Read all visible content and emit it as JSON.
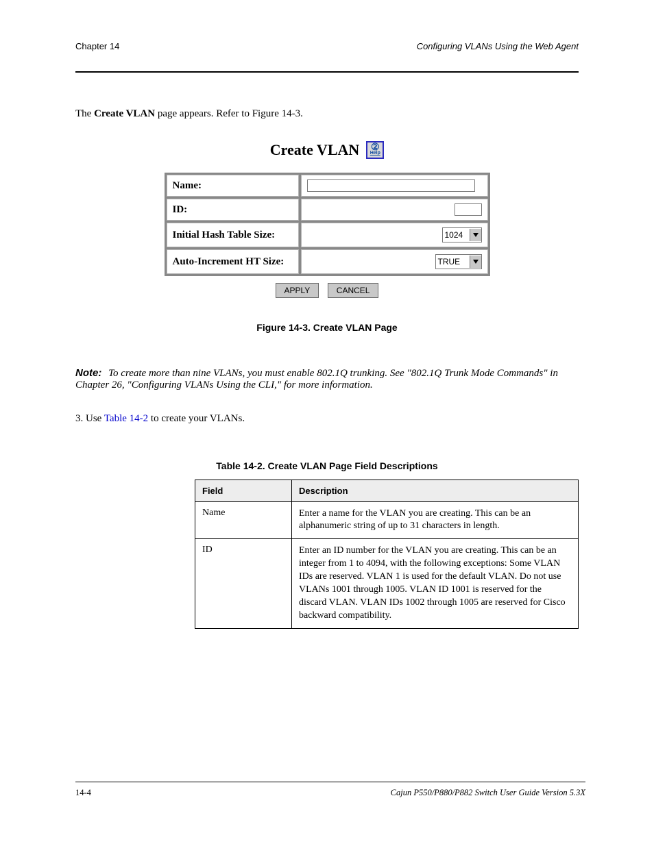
{
  "header": {
    "left": "Chapter 14",
    "right": "Configuring VLANs Using the Web Agent"
  },
  "intro": {
    "text_before_bold": "The ",
    "bold": "Create VLAN",
    "text_after_bold": " page appears. Refer to Figure 14-3."
  },
  "figure": {
    "title": "Create VLAN",
    "help_label": "Help",
    "rows": {
      "name": {
        "label": "Name:",
        "value": ""
      },
      "id": {
        "label": "ID:",
        "value": ""
      },
      "hash": {
        "label": "Initial Hash Table Size:",
        "value": "1024"
      },
      "auto": {
        "label": "Auto-Increment HT Size:",
        "value": "TRUE"
      }
    },
    "buttons": {
      "apply": "APPLY",
      "cancel": "CANCEL"
    },
    "caption": "Figure 14-3. Create VLAN Page"
  },
  "note": {
    "label": "Note:",
    "body": "To create more than nine VLANs, you must enable 802.1Q trunking. See \"802.1Q Trunk Mode Commands\" in Chapter 26, \"Configuring VLANs Using the CLI,\" for more information."
  },
  "action_para": {
    "text_before_link": "3. Use ",
    "link": "Table 14-2",
    "text_after_link": " to create your VLANs."
  },
  "doc_table": {
    "caption": "Table 14-2. Create VLAN Page Field Descriptions",
    "headers": {
      "field": "Field",
      "desc": "Description"
    },
    "rows": [
      {
        "field": "Name",
        "desc": "Enter a name for the VLAN you are creating. This can be an alphanumeric string of up to 31 characters in length."
      },
      {
        "field": "ID",
        "desc": "Enter an ID number for the VLAN you are creating. This can be an integer from 1 to 4094, with the following exceptions: Some VLAN IDs are reserved. VLAN 1 is used for the default VLAN. Do not use VLANs 1001 through 1005. VLAN ID 1001 is reserved for the discard VLAN. VLAN IDs 1002 through 1005 are reserved for Cisco backward compatibility."
      }
    ]
  },
  "footer": {
    "left": "14-4",
    "right": "Cajun P550/P880/P882 Switch User Guide Version 5.3X"
  }
}
